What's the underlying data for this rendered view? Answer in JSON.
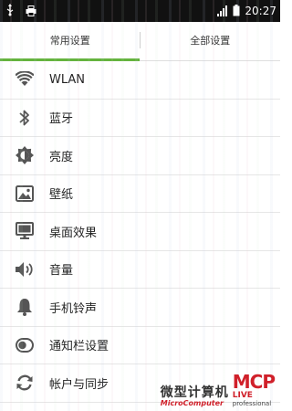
{
  "status_bar": {
    "time": "20:27",
    "icons": [
      "usb-icon",
      "printer-icon",
      "signal-icon",
      "battery-icon"
    ]
  },
  "tabs": [
    {
      "label": "常用设置",
      "selected": true
    },
    {
      "label": "全部设置",
      "selected": false
    }
  ],
  "settings": [
    {
      "label": "WLAN",
      "icon": "wifi-icon"
    },
    {
      "label": "蓝牙",
      "icon": "bluetooth-icon"
    },
    {
      "label": "亮度",
      "icon": "brightness-icon"
    },
    {
      "label": "壁纸",
      "icon": "wallpaper-icon"
    },
    {
      "label": "桌面效果",
      "icon": "desktop-effects-icon"
    },
    {
      "label": "音量",
      "icon": "volume-icon"
    },
    {
      "label": "手机铃声",
      "icon": "ringtone-bell-icon"
    },
    {
      "label": "通知栏设置",
      "icon": "notification-bar-icon"
    },
    {
      "label": "帐户与同步",
      "icon": "sync-icon"
    }
  ],
  "watermark": {
    "cn": "微型计算机",
    "en": "MicroComputer",
    "brand": "MCP",
    "live": "LIVE",
    "pro": "professional"
  },
  "colors": {
    "accent": "#64b33e",
    "icon": "#555555",
    "status_bar": "#111111",
    "watermark_red": "#d0202a"
  }
}
